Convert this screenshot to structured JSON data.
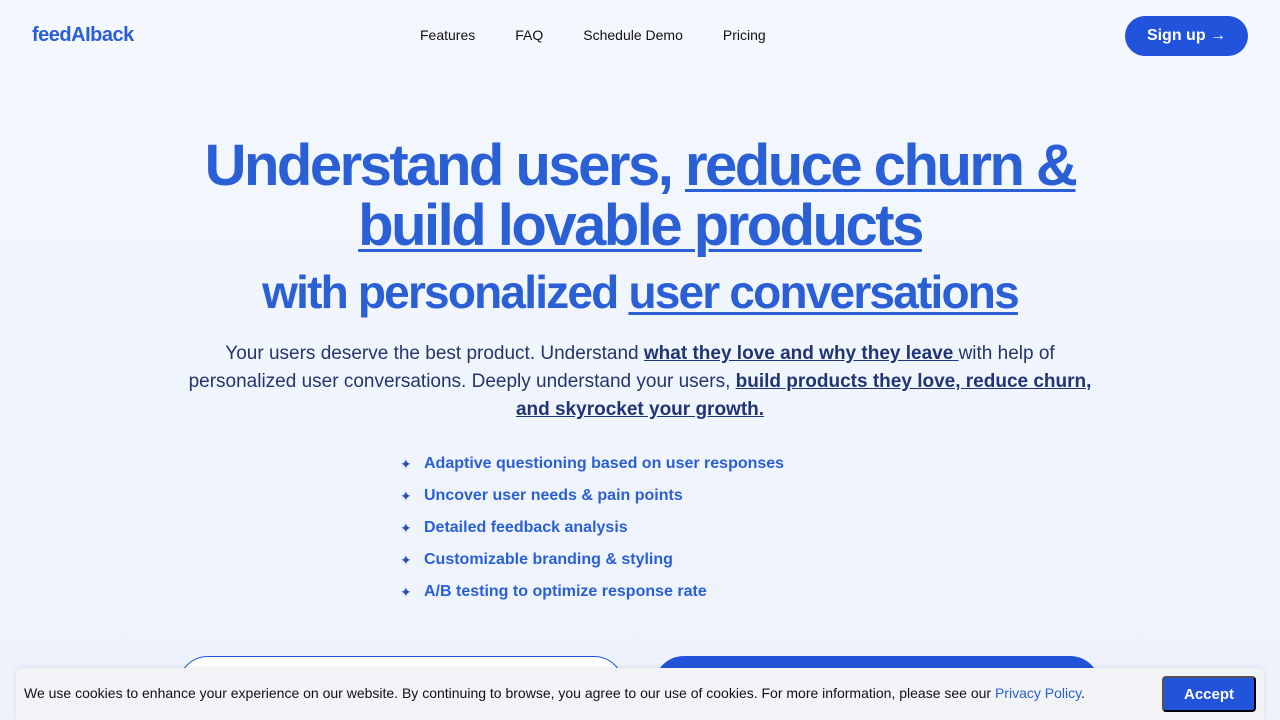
{
  "brand": {
    "logo": "feedAIback"
  },
  "nav": {
    "links": [
      "Features",
      "FAQ",
      "Schedule Demo",
      "Pricing"
    ],
    "signup_label": "Sign up →"
  },
  "hero": {
    "line1_a": "Understand users, ",
    "line1_b": "reduce churn &",
    "line2": "build lovable products",
    "line3_a": "with personalized ",
    "line3_b": "user conversations"
  },
  "subtitle": {
    "p1": "Your users deserve the best product. Understand ",
    "p2": "what they love and why they leave ",
    "p3": "with help of personalized user conversations. Deeply understand your users, ",
    "p4": "build products they love, reduce churn, and skyrocket your growth."
  },
  "features": [
    "Adaptive questioning based on user responses",
    "Uncover user needs & pain points",
    "Detailed feedback analysis",
    "Customizable branding & styling",
    "A/B testing to optimize response rate"
  ],
  "cookie": {
    "text": "We use cookies to enhance your experience on our website. By continuing to browse, you agree to our use of cookies. For more information, please see our ",
    "link": "Privacy Policy",
    "end": ".",
    "accept_label": "Accept"
  },
  "colors": {
    "accent": "#2154db",
    "brand_text": "#2a5fd6"
  }
}
